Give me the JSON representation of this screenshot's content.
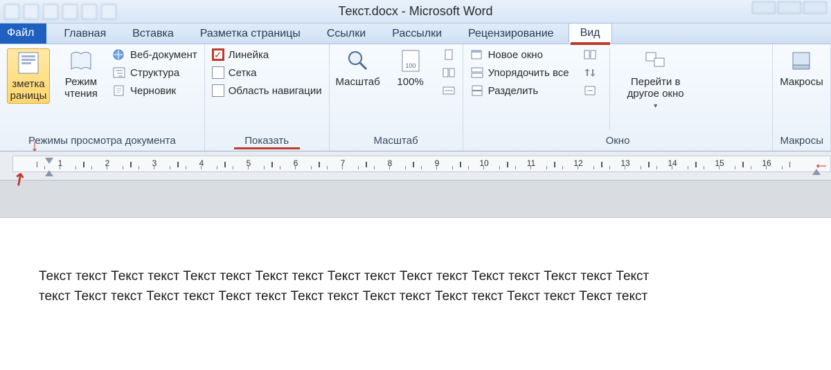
{
  "title": "Текст.docx - Microsoft Word",
  "tabs": {
    "file": "Файл",
    "items": [
      "Главная",
      "Вставка",
      "Разметка страницы",
      "Ссылки",
      "Рассылки",
      "Рецензирование",
      "Вид"
    ],
    "active_index": 6
  },
  "ribbon": {
    "views_group": {
      "label": "Режимы просмотра документа",
      "page_layout": "зметка\nраницы",
      "reading": "Режим\nчтения",
      "web": "Веб-документ",
      "outline": "Структура",
      "draft": "Черновик"
    },
    "show_group": {
      "label": "Показать",
      "ruler": "Линейка",
      "grid": "Сетка",
      "navpane": "Область навигации",
      "ruler_checked": true
    },
    "zoom_group": {
      "label": "Масштаб",
      "zoom": "Масштаб",
      "hundred": "100%"
    },
    "window_group": {
      "label": "Окно",
      "new_window": "Новое окно",
      "arrange_all": "Упорядочить все",
      "split": "Разделить",
      "switch": "Перейти в\nдругое окно"
    },
    "macros_group": {
      "label": "Макросы",
      "macros": "Макросы"
    }
  },
  "ruler": {
    "numbers": [
      "1",
      "2",
      "3",
      "4",
      "5",
      "6",
      "7",
      "8",
      "9",
      "10",
      "11",
      "12",
      "13",
      "14",
      "15",
      "16"
    ]
  },
  "document": {
    "line1": "Текст текст Текст текст Текст текст Текст текст Текст текст Текст текст Текст текст Текст текст Текст",
    "line2": "текст Текст текст Текст текст Текст текст Текст текст Текст текст Текст текст Текст текст Текст текст"
  }
}
